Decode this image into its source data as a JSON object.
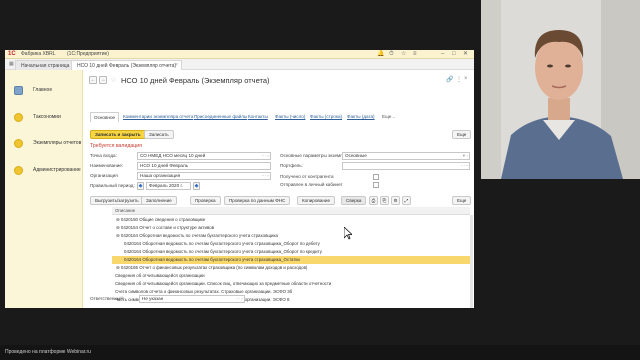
{
  "titlebar": {
    "logo": "1С",
    "app_title": "Фабрика XBRL",
    "app_sub": "(1С:Предприятие)"
  },
  "tabs": [
    {
      "label": "Начальная страница"
    },
    {
      "label": "НСО 10 дней Февраль (Экземпляр отчета)"
    }
  ],
  "sidebar": {
    "items": [
      {
        "label": "Главное"
      },
      {
        "label": "Таксономии"
      },
      {
        "label": "Экземпляры отчетов"
      },
      {
        "label": "Администрирование"
      }
    ]
  },
  "document": {
    "title": "НСО 10 дней Февраль (Экземпляр отчета)",
    "form_tabs": [
      "Основное",
      "Комментарии экземпляра отчета",
      "Присоединенные файлы",
      "Контакты",
      "Факты (число)",
      "Факты (строка)",
      "Факты (дата)",
      "Еще..."
    ],
    "more_label": "Еще",
    "save_close_label": "Записать и закрыть",
    "save_label": "Записать",
    "validation_warning": "Требуется валидация",
    "fields": {
      "entry_point_label": "Точка входа:",
      "entry_point_value": "СО НМЕД НСО месяц 10 дней",
      "name_label": "Наименование:",
      "name_value": "НСО 10 дней Февраль",
      "organization_label": "Организация",
      "organization_value": "Наша организация",
      "period_label": "Правильный период:",
      "period_value": "Февраль 2020 г.",
      "params_label": "Основные параметры экземпляра отчета:",
      "params_value": "Основные",
      "portfolio_label": "Портфель:",
      "received_label": "Получено от контрагента",
      "sent_label": "Отправлен в личный кабинет"
    },
    "toolbar": [
      "Выгрузить/загрузить",
      "Заполнение",
      "Проверка",
      "Проверка по данным ФНС",
      "Копирование",
      "Сверка"
    ],
    "tree": {
      "header": "Описание",
      "rows": [
        {
          "text": "0420150 Общие сведения о страховщике",
          "level": 1,
          "sel": false
        },
        {
          "text": "0420154 Отчет о составе и структуре активов",
          "level": 1,
          "sel": false
        },
        {
          "text": "0420164 Оборотная ведомость по счетам бухгалтерского учета страховщика",
          "level": 1,
          "sel": false
        },
        {
          "text": "0420164 Оборотная ведомость по счетам бухгалтерского учета страховщика_Оборот по дебету",
          "level": 2,
          "sel": false
        },
        {
          "text": "0420164 Оборотная ведомость по счетам бухгалтерского учета страховщика_Оборот по кредиту",
          "level": 2,
          "sel": false
        },
        {
          "text": "0420164 Оборотная ведомость по счетам бухгалтерского учета страховщика_Остатки",
          "level": 2,
          "sel": true
        },
        {
          "text": "0420165 Отчет о финансовых результатах страховщика (по символам доходов и расходов)",
          "level": 1,
          "sel": false
        },
        {
          "text": "Сведения об отчитывающейся организации",
          "level": 0,
          "sel": false
        },
        {
          "text": "Сведения об отчитывающейся организации. Список лиц, отвечающих за предметные области отчетности",
          "level": 0,
          "sel": false
        },
        {
          "text": "Счета символов отчета о финансовых результатах. Страховые организации. ЭСФО 3б",
          "level": 0,
          "sel": false
        },
        {
          "text": "Часть символов отчета о финансовых результатах. Страховые организации. ЭСФО 8",
          "level": 0,
          "sel": false
        }
      ]
    },
    "responsible_label": "Ответственный:",
    "responsible_value": "Не указан"
  },
  "footer": {
    "text": "Проведено на платформе Webinar.ru"
  }
}
